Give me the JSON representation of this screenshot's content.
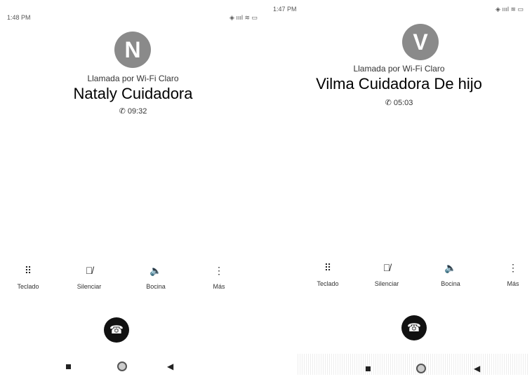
{
  "screens": [
    {
      "status": {
        "time": "1:48 PM",
        "icons": "◈ ıııl ≋ ▭"
      },
      "avatar_letter": "N",
      "wifi_label": "Llamada por Wi-Fi Claro",
      "caller_name": "Nataly Cuidadora",
      "duration": "09:32",
      "controls": [
        {
          "icon": "dialpad-icon",
          "glyph": "⠿",
          "label": "Teclado"
        },
        {
          "icon": "mic-off-icon",
          "glyph": "🎙",
          "label": "Silenciar"
        },
        {
          "icon": "speaker-icon",
          "glyph": "🔈",
          "label": "Bocina"
        },
        {
          "icon": "more-icon",
          "glyph": "⋮",
          "label": "Más"
        }
      ]
    },
    {
      "status": {
        "time": "1:47 PM",
        "icons": "◈ ıııl ≋ ▭"
      },
      "avatar_letter": "V",
      "wifi_label": "Llamada por Wi-Fi Claro",
      "caller_name": "Vilma Cuidadora De hijo",
      "duration": "05:03",
      "controls": [
        {
          "icon": "dialpad-icon",
          "glyph": "⠿",
          "label": "Teclado"
        },
        {
          "icon": "mic-off-icon",
          "glyph": "🎙",
          "label": "Silenciar"
        },
        {
          "icon": "speaker-icon",
          "glyph": "🔈",
          "label": "Bocina"
        },
        {
          "icon": "more-icon",
          "glyph": "⋮",
          "label": "Más"
        }
      ]
    }
  ],
  "colors": {
    "hangup": "#111111",
    "avatar": "#8a8a8a"
  }
}
